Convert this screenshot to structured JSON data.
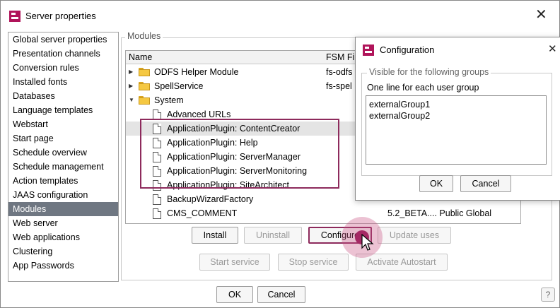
{
  "window": {
    "title": "Server properties",
    "close_glyph": "✕",
    "help_glyph": "?"
  },
  "sidebar": {
    "items": [
      {
        "label": "Global server properties"
      },
      {
        "label": "Presentation channels"
      },
      {
        "label": "Conversion rules"
      },
      {
        "label": "Installed fonts"
      },
      {
        "label": "Databases"
      },
      {
        "label": "Language templates"
      },
      {
        "label": "Webstart"
      },
      {
        "label": "Start page"
      },
      {
        "label": "Schedule overview"
      },
      {
        "label": "Schedule management"
      },
      {
        "label": "Action templates"
      },
      {
        "label": "JAAS configuration"
      },
      {
        "label": "Modules"
      },
      {
        "label": "Web server"
      },
      {
        "label": "Web applications"
      },
      {
        "label": "Clustering"
      },
      {
        "label": "App Passwords"
      }
    ],
    "selected": "Modules"
  },
  "modules": {
    "legend": "Modules",
    "columns": {
      "name": "Name",
      "fsm": "FSM Fi"
    },
    "rows": [
      {
        "name": "ODFS Helper Module",
        "fsm": "fs-odfs",
        "extra": ""
      },
      {
        "name": "SpellService",
        "fsm": "fs-spel",
        "extra": ""
      },
      {
        "name": "System",
        "fsm": "",
        "extra": ""
      },
      {
        "name": "Advanced URLs",
        "fsm": "",
        "extra": ""
      },
      {
        "name": "ApplicationPlugin: ContentCreator",
        "fsm": "",
        "extra": ""
      },
      {
        "name": "ApplicationPlugin: Help",
        "fsm": "",
        "extra": ""
      },
      {
        "name": "ApplicationPlugin: ServerManager",
        "fsm": "",
        "extra": ""
      },
      {
        "name": "ApplicationPlugin: ServerMonitoring",
        "fsm": "",
        "extra": ""
      },
      {
        "name": "ApplicationPlugin: SiteArchitect",
        "fsm": "",
        "extra": ""
      },
      {
        "name": "BackupWizardFactory",
        "fsm": "",
        "extra": ""
      },
      {
        "name": "CMS_COMMENT",
        "fsm": "",
        "extra": "5.2_BETA.... Public  Global"
      }
    ]
  },
  "buttons": {
    "install": "Install",
    "uninstall": "Uninstall",
    "configure": "Configure",
    "update_uses": "Update uses",
    "start_service": "Start service",
    "stop_service": "Stop service",
    "activate_autostart": "Activate Autostart",
    "ok": "OK",
    "cancel": "Cancel"
  },
  "dialog": {
    "title": "Configuration",
    "close_glyph": "✕",
    "legend": "Visible for the following groups",
    "label": "One line for each user group",
    "groups": [
      "externalGroup1",
      "externalGroup2"
    ],
    "ok": "OK",
    "cancel": "Cancel"
  },
  "colors": {
    "accent": "#b0145a",
    "highlight_border": "#8d2a5c",
    "selected_item": "#6f7782"
  }
}
